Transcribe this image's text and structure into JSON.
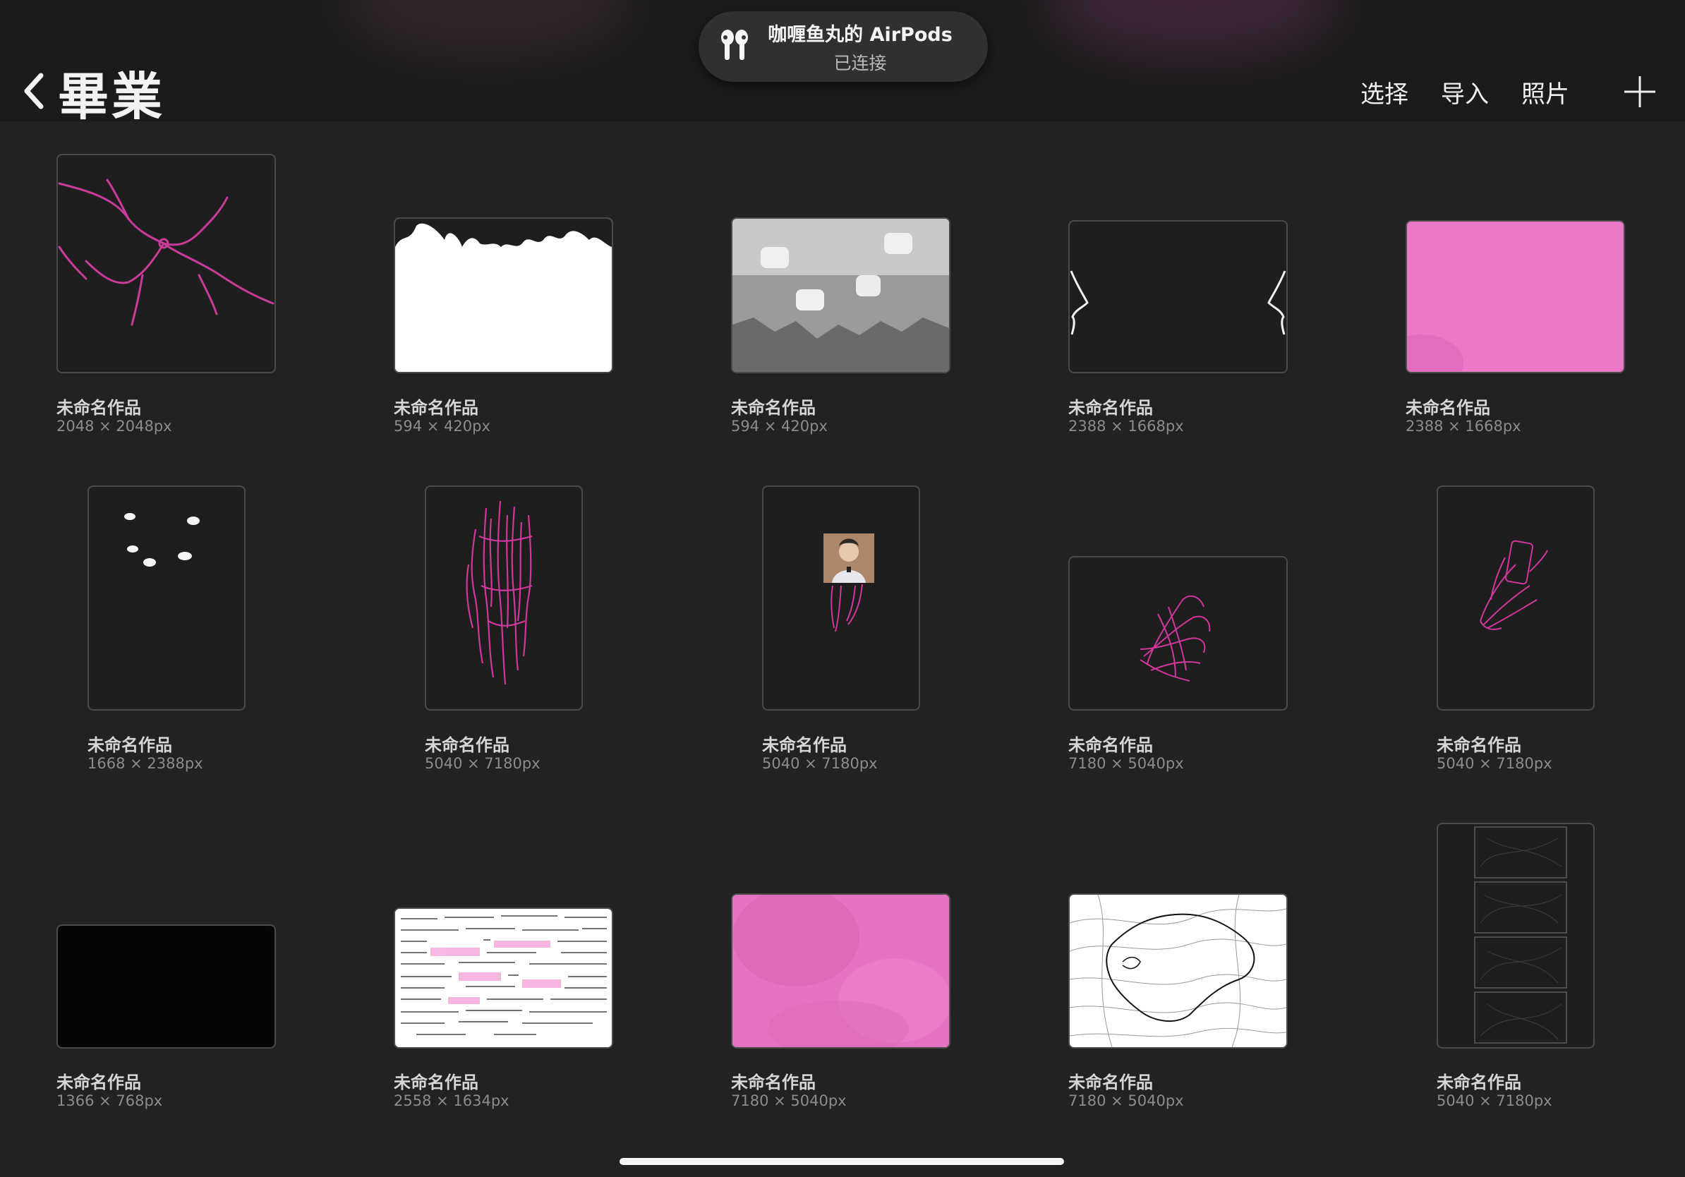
{
  "header": {
    "title": "畢業",
    "actions": {
      "select": "选择",
      "import": "导入",
      "photos": "照片"
    }
  },
  "notification": {
    "device": "咖喱鱼丸的 AirPods",
    "status": "已连接"
  },
  "artworks": [
    {
      "name": "未命名作品",
      "size": "2048 × 2048px"
    },
    {
      "name": "未命名作品",
      "size": "594 × 420px"
    },
    {
      "name": "未命名作品",
      "size": "594 × 420px"
    },
    {
      "name": "未命名作品",
      "size": "2388 × 1668px"
    },
    {
      "name": "未命名作品",
      "size": "2388 × 1668px"
    },
    {
      "name": "未命名作品",
      "size": "1668 × 2388px"
    },
    {
      "name": "未命名作品",
      "size": "5040 × 7180px"
    },
    {
      "name": "未命名作品",
      "size": "5040 × 7180px"
    },
    {
      "name": "未命名作品",
      "size": "7180 × 5040px"
    },
    {
      "name": "未命名作品",
      "size": "5040 × 7180px"
    },
    {
      "name": "未命名作品",
      "size": "1366 × 768px"
    },
    {
      "name": "未命名作品",
      "size": "2558 × 1634px"
    },
    {
      "name": "未命名作品",
      "size": "7180 × 5040px"
    },
    {
      "name": "未命名作品",
      "size": "7180 × 5040px"
    },
    {
      "name": "未命名作品",
      "size": "5040 × 7180px"
    }
  ],
  "colors": {
    "background": "#222222",
    "accent_pink": "#ea7ac8",
    "stroke_magenta": "#d0379c"
  }
}
